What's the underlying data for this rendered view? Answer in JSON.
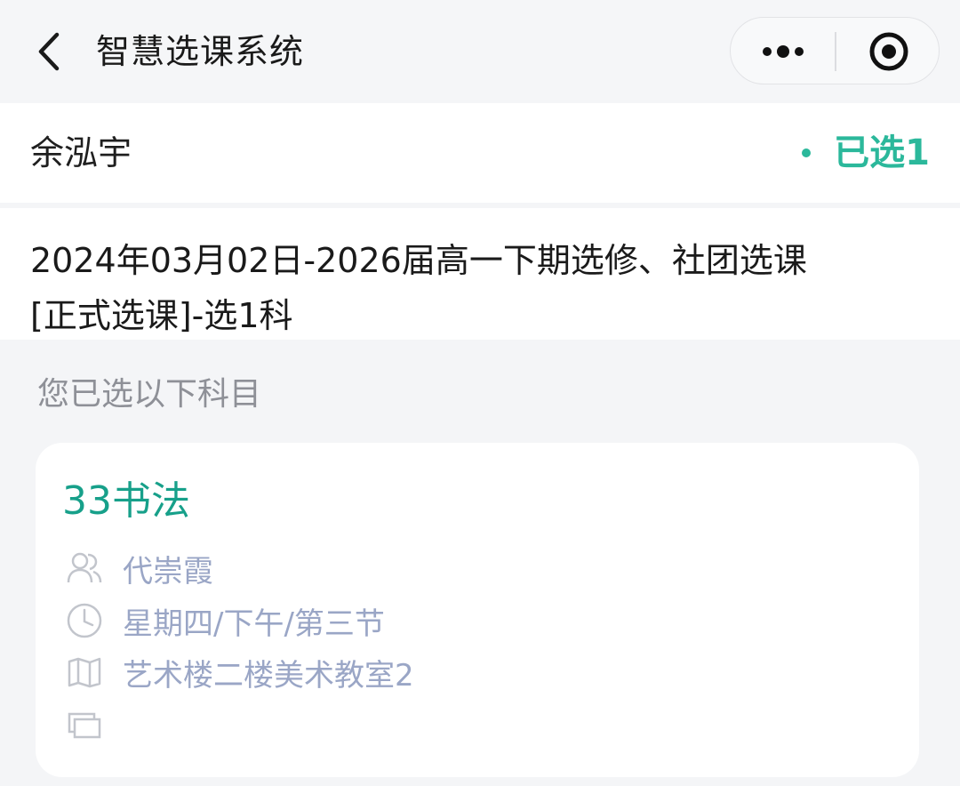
{
  "navbar": {
    "title": "智慧选课系统"
  },
  "student": {
    "name": "余泓宇",
    "status": "已选1"
  },
  "session": {
    "title_line1": "2024年03月02日-2026届高一下期选修、社团选课",
    "title_line2": "[正式选课]-选1科"
  },
  "selected_section": {
    "label": "您已选以下科目"
  },
  "course": {
    "name": "33书法",
    "teacher": "代崇霞",
    "time": "星期四/下午/第三节",
    "location": "艺术楼二楼美术教室2",
    "note": ""
  },
  "colors": {
    "accent": "#2bb89b",
    "course_title": "#17a08a",
    "info_text": "#9aa6c6",
    "muted_label": "#8e9097",
    "background": "#f4f5f7"
  },
  "icons": {
    "back": "chevron-left-icon",
    "more": "more-dots-icon",
    "close": "target-circle-icon",
    "teacher": "users-icon",
    "time": "clock-icon",
    "location": "map-icon",
    "note": "folder-icon"
  }
}
